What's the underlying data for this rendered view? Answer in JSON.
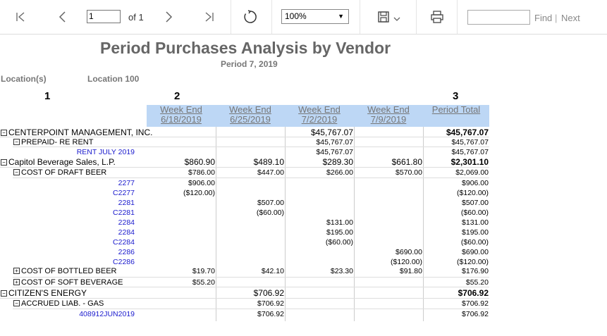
{
  "toolbar": {
    "page_value": "1",
    "of_label": "of 1",
    "zoom_value": "100%",
    "find_label": "Find",
    "separator": "|",
    "next_label": "Next"
  },
  "report": {
    "title": "Period Purchases Analysis by Vendor",
    "subtitle": "Period 7, 2019",
    "location_label": "Location(s)",
    "location_value": "Location 100",
    "col_numbers": [
      "1",
      "2",
      "3"
    ],
    "weeks": [
      {
        "line1": "Week End",
        "line2": "6/18/2019"
      },
      {
        "line1": "Week End",
        "line2": "6/25/2019"
      },
      {
        "line1": "Week End",
        "line2": "7/2/2019"
      },
      {
        "line1": "Week End",
        "line2": "7/9/2019"
      }
    ],
    "total_header": "Period Total",
    "rows": [
      {
        "level": 0,
        "toggle": "minus",
        "label": "CENTERPOINT MANAGEMENT, INC.",
        "vals": [
          "",
          "",
          "$45,767.07",
          ""
        ],
        "total": "$45,767.07"
      },
      {
        "level": 1,
        "toggle": "minus",
        "label": "PREPAID- RE RENT",
        "vals": [
          "",
          "",
          "$45,767.07",
          ""
        ],
        "total": "$45,767.07"
      },
      {
        "level": 2,
        "toggle": "",
        "label": "RENT JULY 2019",
        "vals": [
          "",
          "",
          "$45,767.07",
          ""
        ],
        "total": "$45,767.07"
      },
      {
        "level": 0,
        "toggle": "minus",
        "label": "Capitol Beverage Sales, L.P.",
        "vals": [
          "$860.90",
          "$489.10",
          "$289.30",
          "$661.80"
        ],
        "total": "$2,301.10"
      },
      {
        "level": 1,
        "toggle": "minus",
        "label": "COST OF  DRAFT BEER",
        "vals": [
          "$786.00",
          "$447.00",
          "$266.00",
          "$570.00"
        ],
        "total": "$2,069.00"
      },
      {
        "level": 2,
        "toggle": "",
        "label": "2277",
        "vals": [
          "$906.00",
          "",
          "",
          ""
        ],
        "total": "$906.00"
      },
      {
        "level": 2,
        "toggle": "",
        "label": "C2277",
        "vals": [
          "($120.00)",
          "",
          "",
          ""
        ],
        "total": "($120.00)"
      },
      {
        "level": 2,
        "toggle": "",
        "label": "2281",
        "vals": [
          "",
          "$507.00",
          "",
          ""
        ],
        "total": "$507.00"
      },
      {
        "level": 2,
        "toggle": "",
        "label": "C2281",
        "vals": [
          "",
          "($60.00)",
          "",
          ""
        ],
        "total": "($60.00)"
      },
      {
        "level": 2,
        "toggle": "",
        "label": "2284",
        "vals": [
          "",
          "",
          "$131.00",
          ""
        ],
        "total": "$131.00"
      },
      {
        "level": 2,
        "toggle": "",
        "label": "2284",
        "vals": [
          "",
          "",
          "$195.00",
          ""
        ],
        "total": "$195.00"
      },
      {
        "level": 2,
        "toggle": "",
        "label": "C2284",
        "vals": [
          "",
          "",
          "($60.00)",
          ""
        ],
        "total": "($60.00)"
      },
      {
        "level": 2,
        "toggle": "",
        "label": "2286",
        "vals": [
          "",
          "",
          "",
          "$690.00"
        ],
        "total": "$690.00"
      },
      {
        "level": 2,
        "toggle": "",
        "label": "C2286",
        "vals": [
          "",
          "",
          "",
          "($120.00)"
        ],
        "total": "($120.00)"
      },
      {
        "level": 1,
        "toggle": "plus",
        "label": "COST OF BOTTLED BEER",
        "vals": [
          "$19.70",
          "$42.10",
          "$23.30",
          "$91.80"
        ],
        "total": "$176.90"
      },
      {
        "level": 1,
        "toggle": "plus",
        "label": "COST OF SOFT BEVERAGE",
        "vals": [
          "$55.20",
          "",
          "",
          ""
        ],
        "total": "$55.20"
      },
      {
        "level": 0,
        "toggle": "minus",
        "label": "CITIZEN'S  ENERGY",
        "vals": [
          "",
          "$706.92",
          "",
          ""
        ],
        "total": "$706.92"
      },
      {
        "level": 1,
        "toggle": "minus",
        "label": "ACCRUED LIAB. - GAS",
        "vals": [
          "",
          "$706.92",
          "",
          ""
        ],
        "total": "$706.92"
      },
      {
        "level": 2,
        "toggle": "",
        "label": "408912JUN2019",
        "vals": [
          "",
          "$706.92",
          "",
          ""
        ],
        "total": "$706.92"
      }
    ]
  },
  "colors": {
    "header_band": "#bdd7f5",
    "detail_link": "#1a1acd",
    "title_gray": "#666666"
  }
}
